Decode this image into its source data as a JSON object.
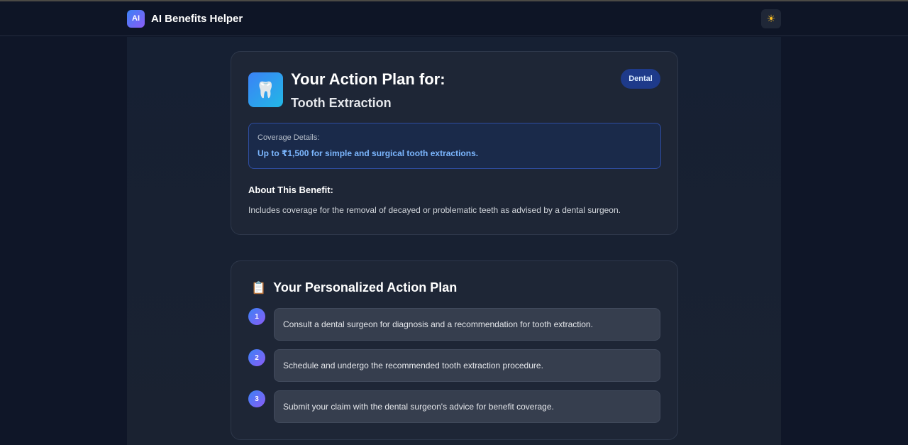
{
  "header": {
    "logo_text": "AI",
    "app_name": "AI Benefits Helper",
    "theme_icon": "sun-icon",
    "theme_glyph": "☀"
  },
  "plan": {
    "icon": "tooth-icon",
    "icon_glyph": "🦷",
    "title": "Your Action Plan for:",
    "subtitle": "Tooth Extraction",
    "category": "Dental",
    "coverage_label": "Coverage Details:",
    "coverage_text": "Up to ₹1,500 for simple and surgical tooth extractions.",
    "about_heading": "About This Benefit:",
    "about_text": "Includes coverage for the removal of decayed or problematic teeth as advised by a dental surgeon."
  },
  "action_plan": {
    "icon": "clipboard-icon",
    "icon_glyph": "📋",
    "title": "Your Personalized Action Plan",
    "steps": [
      {
        "number": "1",
        "text": "Consult a dental surgeon for diagnosis and a recommendation for tooth extraction."
      },
      {
        "number": "2",
        "text": "Schedule and undergo the recommended tooth extraction procedure."
      },
      {
        "number": "3",
        "text": "Submit your claim with the dental surgeon's advice for benefit coverage."
      }
    ]
  },
  "colors": {
    "background": "#0f1628",
    "card": "#1e2636",
    "accent_blue": "#3b82f6",
    "accent_purple": "#8b5cf6",
    "coverage_text": "#7cb7ff",
    "badge": "#1e3a8a"
  }
}
